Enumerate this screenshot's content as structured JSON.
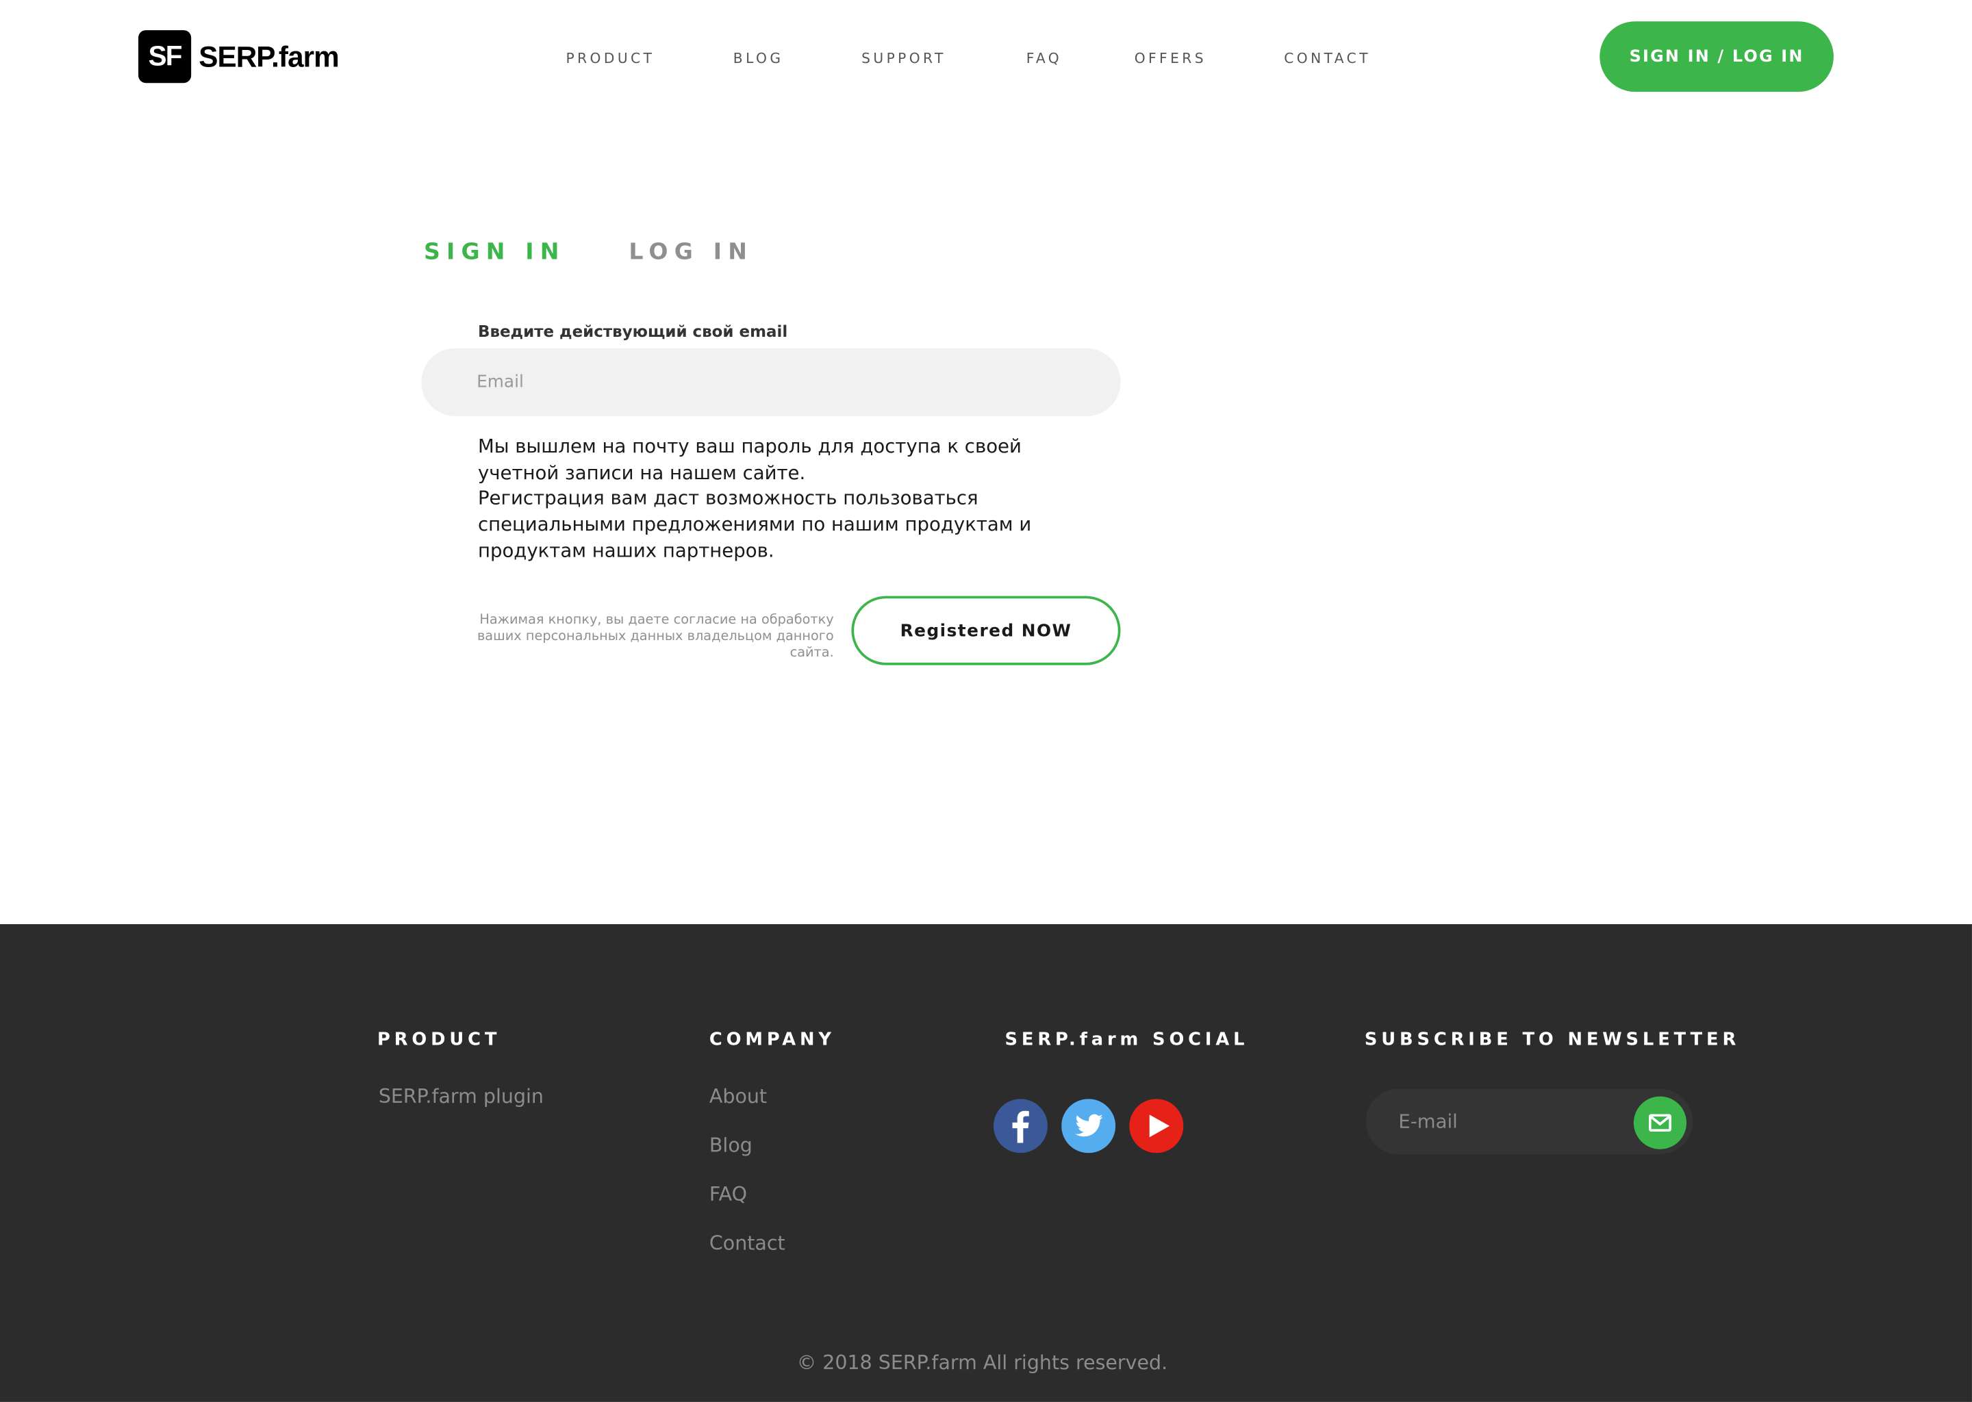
{
  "brand": {
    "mark": "SF",
    "name": "SERP.farm"
  },
  "nav": {
    "items": [
      "PRODUCT",
      "BLOG",
      "SUPPORT",
      "FAQ",
      "OFFERS",
      "CONTACT"
    ],
    "signin_button": "SIGN IN / LOG IN"
  },
  "auth": {
    "tabs": {
      "active": "SIGN IN",
      "inactive": "LOG IN"
    },
    "email_label": "Введите действующий свой email",
    "email_placeholder": "Email",
    "info_lines": [
      "Мы вышлем на почту ваш пароль для доступа к своей учетной записи на нашем сайте.",
      "Регистрация вам даст возможность пользоваться специальными предложениями по нашим продуктам и продуктам наших партнеров."
    ],
    "consent_text": "Нажимая кнопку, вы даете согласие на обработку ваших персональных данных владельцом данного сайта.",
    "register_button": "Registered NOW"
  },
  "footer": {
    "product": {
      "heading": "PRODUCT",
      "links": [
        "SERP.farm plugin"
      ]
    },
    "company": {
      "heading": "COMPANY",
      "links": [
        "About",
        "Blog",
        "FAQ",
        "Contact"
      ]
    },
    "social": {
      "heading": "SERP.farm SOCIAL",
      "icons": [
        "facebook-icon",
        "twitter-icon",
        "youtube-icon"
      ]
    },
    "newsletter": {
      "heading": "SUBSCRIBE TO NEWSLETTER",
      "placeholder": "E-mail"
    },
    "copyright": "© 2018 SERP.farm All rights reserved."
  },
  "colors": {
    "accent": "#3cb54a",
    "footer_bg": "#2c2c2c",
    "facebook": "#3b5998",
    "twitter": "#55acee",
    "youtube": "#e62117"
  }
}
